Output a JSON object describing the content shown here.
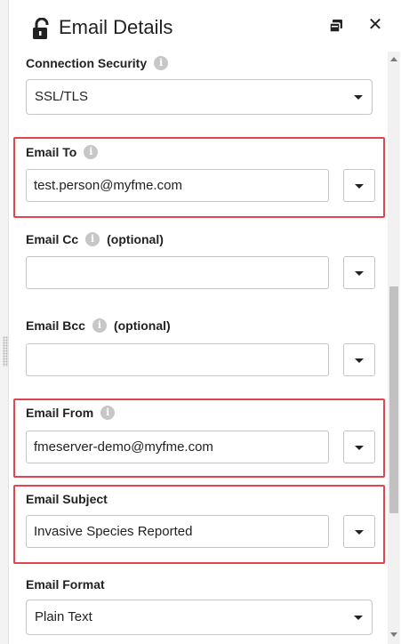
{
  "header": {
    "title": "Email Details",
    "lock_icon": "unlocked-lock-icon",
    "popout_icon": "popout-window-icon",
    "close_glyph": "✕"
  },
  "colors": {
    "highlight": "#e0464f",
    "info_icon": "#c7c7c7",
    "border": "#c4c4c4"
  },
  "fields": {
    "connection_security": {
      "label": "Connection Security",
      "value": "SSL/TLS"
    },
    "email_to": {
      "label": "Email To",
      "value": "test.person@myfme.com"
    },
    "email_cc": {
      "label": "Email Cc",
      "optional": "(optional)",
      "value": ""
    },
    "email_bcc": {
      "label": "Email Bcc",
      "optional": "(optional)",
      "value": ""
    },
    "email_from": {
      "label": "Email From",
      "value": "fmeserver-demo@myfme.com"
    },
    "email_subject": {
      "label": "Email Subject",
      "value": "Invasive Species Reported"
    },
    "email_format": {
      "label": "Email Format",
      "value": "Plain Text"
    }
  },
  "info_glyph": "i"
}
